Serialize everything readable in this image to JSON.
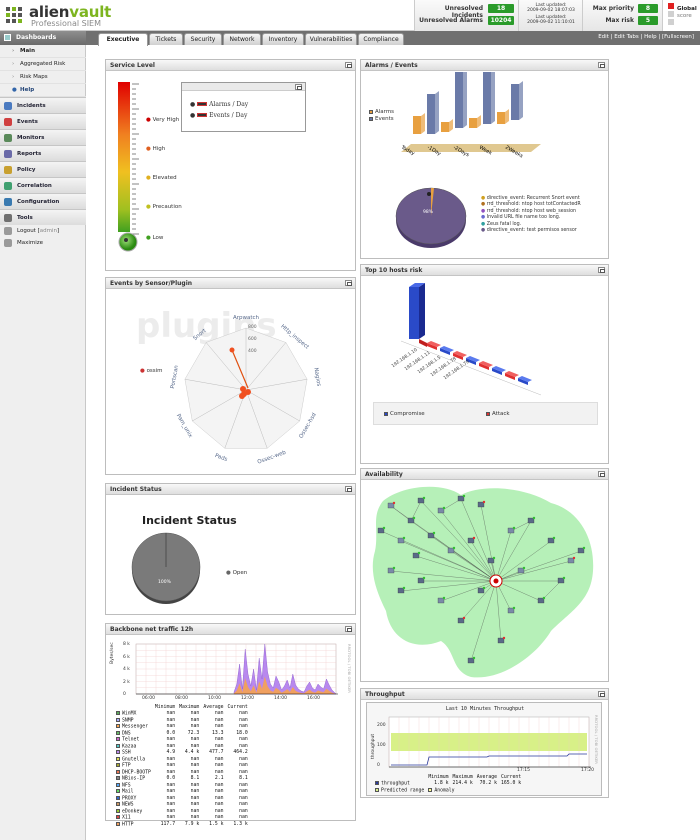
{
  "header": {
    "brand_main": "alien",
    "brand_accent": "vault",
    "tagline": "Professional SIEM",
    "unresolved_incidents_label": "Unresolved Incidents",
    "unresolved_incidents_count": "18",
    "unresolved_alarms_label": "Unresolved Alarms",
    "unresolved_alarms_count": "10204",
    "last_updated_label": "Last updated:",
    "last_updated_1": "2009-09-02 18:07:03",
    "last_updated_2": "2009-09-02 11:10:01",
    "max_priority_label": "Max priority",
    "max_priority_value": "8",
    "max_risk_label": "Max risk",
    "max_risk_value": "5",
    "global_label": "Global",
    "score_label": "score"
  },
  "sidebar": {
    "dashboards": "Dashboards",
    "items": [
      "Main",
      "Aggregated Risk",
      "Risk Maps",
      "Help"
    ],
    "sections": [
      "Incidents",
      "Events",
      "Monitors",
      "Reports",
      "Policy",
      "Correlation",
      "Configuration",
      "Tools"
    ],
    "logout": "Logout",
    "logout_user": "admin",
    "maximize": "Maximize"
  },
  "tabs": [
    "Executive",
    "Tickets",
    "Security",
    "Network",
    "Inventory",
    "Vulnerabilities",
    "Compliance"
  ],
  "tab_links": "Edit | Edit Tabs | Help | [Fullscreen]",
  "panels": {
    "service_level": {
      "title": "Service Level",
      "levels": [
        "Very High",
        "High",
        "Elevated",
        "Precaution",
        "Low"
      ],
      "legend": [
        "Alarms / Day",
        "Events / Day"
      ]
    },
    "alarms_events": {
      "title": "Alarms / Events",
      "legend": [
        "Alarms",
        "Events"
      ],
      "periods": [
        "Today",
        "-1Day",
        "-2Days",
        "Week",
        "2Weeks"
      ],
      "pie_label": "98%",
      "pie_legend": [
        "directive_event: Recurrent Snort event",
        "rrd_threshold: ntop host totContactedR",
        "rrd_threshold: ntop host web_session",
        "Invalid URL file name too long.",
        "Zeus fatal log.",
        "directive_event: test permisos sensor"
      ]
    },
    "sensor_plugin": {
      "title": "Events by Sensor/Plugin",
      "watermark": "plugins",
      "legend": "ossim",
      "axes": [
        "Arpwatch",
        "Http_inspect",
        "Nagios",
        "Ossec-hsd",
        "Ossec-web",
        "Pads",
        "Pam_unix",
        "Portscan",
        "Snort"
      ],
      "ticks": [
        "800",
        "600",
        "400"
      ]
    },
    "top_hosts": {
      "title": "Top 10 hosts risk",
      "hosts": [
        "192.168.1.10",
        "192.168.1.11",
        "192.168.1.5",
        "192.168.1.78",
        "192.168.1.79"
      ],
      "legend": [
        "Compromise",
        "Attack"
      ]
    },
    "incident_status": {
      "title": "Incident Status",
      "chart_title": "Incident Status",
      "pie_label": "100%",
      "legend": "Open"
    },
    "availability": {
      "title": "Availability"
    },
    "backbone": {
      "title": "Backbone net traffic 12h",
      "ylabel": "Bytes/sec",
      "yticks": [
        "8 k",
        "6 k",
        "4 k",
        "2 k",
        "0"
      ],
      "xticks": [
        "06:00",
        "08:00",
        "10:00",
        "12:00",
        "14:00",
        "16:00"
      ],
      "side_text": "RRDTOOL / TOBI OETIKER",
      "columns": [
        "Minimum",
        "Maximum",
        "Average",
        "Current"
      ],
      "rows": [
        {
          "name": "WinMX",
          "v": [
            "nan",
            "nan",
            "nan",
            "nan"
          ],
          "c": "#5aaa5a"
        },
        {
          "name": "SNMP",
          "v": [
            "nan",
            "nan",
            "nan",
            "nan"
          ],
          "c": "#aaaaff"
        },
        {
          "name": "Messenger",
          "v": [
            "nan",
            "nan",
            "nan",
            "nan"
          ],
          "c": "#ffaa55"
        },
        {
          "name": "DNS",
          "v": [
            "0.0",
            "72.3",
            "13.3",
            "18.0"
          ],
          "c": "#66bb66"
        },
        {
          "name": "Telnet",
          "v": [
            "nan",
            "nan",
            "nan",
            "nan"
          ],
          "c": "#cc66cc"
        },
        {
          "name": "Kazaa",
          "v": [
            "nan",
            "nan",
            "nan",
            "nan"
          ],
          "c": "#55cccc"
        },
        {
          "name": "SSH",
          "v": [
            "4.9",
            "4.4 k",
            "477.7",
            "464.2"
          ],
          "c": "#bb88ee"
        },
        {
          "name": "Gnutella",
          "v": [
            "nan",
            "nan",
            "nan",
            "nan"
          ],
          "c": "#dddd55"
        },
        {
          "name": "FTP",
          "v": [
            "nan",
            "nan",
            "nan",
            "nan"
          ],
          "c": "#aaaa33"
        },
        {
          "name": "DHCP-BOOTP",
          "v": [
            "nan",
            "nan",
            "nan",
            "nan"
          ],
          "c": "#ee7755"
        },
        {
          "name": "NBios-IP",
          "v": [
            "0.0",
            "8.1",
            "2.1",
            "8.1"
          ],
          "c": "#888888"
        },
        {
          "name": "NFS",
          "v": [
            "nan",
            "nan",
            "nan",
            "nan"
          ],
          "c": "#55aaff"
        },
        {
          "name": "Mail",
          "v": [
            "nan",
            "nan",
            "nan",
            "nan"
          ],
          "c": "#66dd66"
        },
        {
          "name": "PROXY",
          "v": [
            "nan",
            "nan",
            "nan",
            "nan"
          ],
          "c": "#3366cc"
        },
        {
          "name": "NEWS",
          "v": [
            "nan",
            "nan",
            "nan",
            "nan"
          ],
          "c": "#cc9966"
        },
        {
          "name": "eDonkey",
          "v": [
            "nan",
            "nan",
            "nan",
            "nan"
          ],
          "c": "#99cc33"
        },
        {
          "name": "X11",
          "v": [
            "nan",
            "nan",
            "nan",
            "nan"
          ],
          "c": "#dd4444"
        },
        {
          "name": "HTTP",
          "v": [
            "117.7",
            "7.9 k",
            "1.5 k",
            "1.3 k"
          ],
          "c": "#f0a060"
        }
      ]
    },
    "throughput": {
      "title": "Throughput",
      "chart_title": "Last 10 Minutes Throughput",
      "ylabel": "throughput",
      "yticks": [
        "200",
        "100",
        "0"
      ],
      "xticks": [
        "17:15",
        "17:20"
      ],
      "side_text": "RRDTOOL / TOBI OETIKER",
      "columns": [
        "Minimum",
        "Maximum",
        "Average",
        "Current"
      ],
      "row_name": "throughput",
      "row_values": [
        "1.8 k",
        "214.4 k",
        "70.2 k",
        "165.0 k"
      ],
      "legend": [
        "Predicted range",
        "Anomaly"
      ]
    }
  }
}
